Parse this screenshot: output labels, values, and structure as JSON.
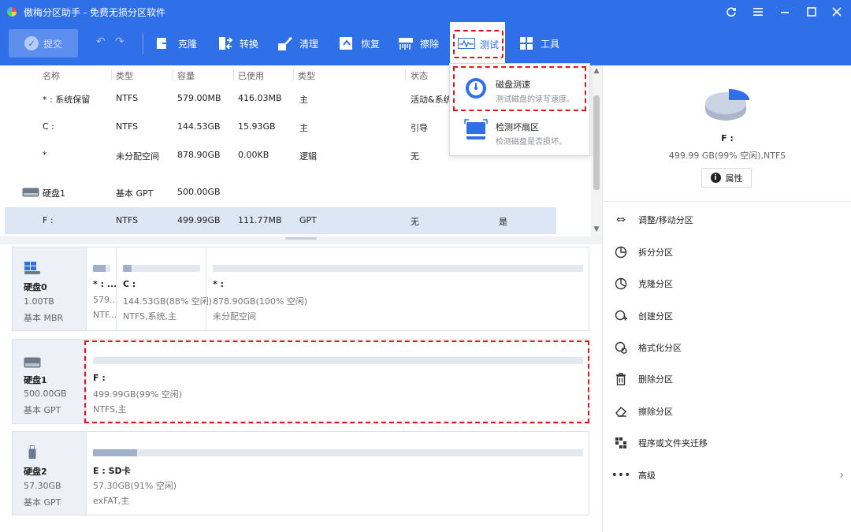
{
  "window": {
    "title": "傲梅分区助手 - 免费无损分区软件",
    "controls": [
      "refresh-icon",
      "menu-icon",
      "minimize-icon",
      "maximize-icon",
      "close-icon"
    ]
  },
  "toolbar": {
    "submit_label": "提交",
    "tools": [
      {
        "id": "clone",
        "label": "克隆",
        "icon": "clone-icon"
      },
      {
        "id": "convert",
        "label": "转换",
        "icon": "convert-icon"
      },
      {
        "id": "clean",
        "label": "清理",
        "icon": "clean-icon"
      },
      {
        "id": "recover",
        "label": "恢复",
        "icon": "recover-icon"
      },
      {
        "id": "wipe",
        "label": "擦除",
        "icon": "wipe-icon"
      },
      {
        "id": "test",
        "label": "测试",
        "icon": "test-icon"
      },
      {
        "id": "tools",
        "label": "工具",
        "icon": "tools-icon"
      }
    ],
    "active_tool": "test"
  },
  "table": {
    "headers": [
      "名称",
      "类型",
      "容量",
      "已使用",
      "类型",
      "状态"
    ],
    "rows": [
      {
        "name": "* : 系统保留",
        "type": "NTFS",
        "capacity": "579.00MB",
        "used": "416.03MB",
        "kind": "主",
        "status": "活动&系统"
      },
      {
        "name": "C :",
        "type": "NTFS",
        "capacity": "144.53GB",
        "used": "15.93GB",
        "kind": "主",
        "status": "引导"
      },
      {
        "name": "*",
        "type": "未分配空间",
        "capacity": "878.90GB",
        "used": "0.00KB",
        "kind": "逻辑",
        "status": "无"
      },
      {
        "name": "硬盘1",
        "type": "基本 GPT",
        "capacity": "500.00GB",
        "used": "",
        "kind": "",
        "status": ""
      },
      {
        "name": "F :",
        "type": "NTFS",
        "capacity": "499.99GB",
        "used": "111.77MB",
        "kind": "GPT",
        "status": "无",
        "extra": "是"
      }
    ]
  },
  "disks": [
    {
      "name": "硬盘0",
      "size": "1.00TB",
      "style": "基本 MBR",
      "partitions": [
        {
          "name": "* : ...",
          "line1": "579...",
          "line2": "NTF...",
          "used_fraction": 0.72
        },
        {
          "name": "C :",
          "line1": "144.53GB(88% 空闲)",
          "line2": "NTFS,系统,主",
          "used_fraction": 0.11
        },
        {
          "name": "* :",
          "line1": "878.90GB(100% 空闲)",
          "line2": "未分配空间",
          "used_fraction": 0.0
        }
      ]
    },
    {
      "name": "硬盘1",
      "size": "500.00GB",
      "style": "基本 GPT",
      "partitions": [
        {
          "name": "F :",
          "line1": "499.99GB(99% 空闲)",
          "line2": "NTFS,主",
          "used_fraction": 0.0
        }
      ]
    },
    {
      "name": "硬盘2",
      "size": "57.30GB",
      "style": "基本 GPT",
      "partitions": [
        {
          "name": "E : SD卡",
          "line1": "57.30GB(91% 空闲)",
          "line2": "exFAT,主",
          "used_fraction": 0.09
        }
      ]
    }
  ],
  "dropdown": {
    "items": [
      {
        "title": "磁盘测速",
        "desc": "测试磁盘的读写速度。",
        "icon": "speed-gauge-icon"
      },
      {
        "title": "检测坏扇区",
        "desc": "检测磁盘是否损坏。",
        "icon": "bad-sector-icon"
      }
    ]
  },
  "right_panel": {
    "partition_name": "F :",
    "partition_info": "499.99 GB(99% 空闲),NTFS",
    "properties_label": "属性",
    "pie_used_fraction": 0.25,
    "operations": [
      {
        "label": "调整/移动分区",
        "icon": "resize-icon"
      },
      {
        "label": "拆分分区",
        "icon": "split-icon"
      },
      {
        "label": "克隆分区",
        "icon": "clone-partition-icon"
      },
      {
        "label": "创建分区",
        "icon": "create-partition-icon"
      },
      {
        "label": "格式化分区",
        "icon": "format-icon"
      },
      {
        "label": "删除分区",
        "icon": "delete-icon"
      },
      {
        "label": "擦除分区",
        "icon": "erase-icon"
      },
      {
        "label": "程序或文件夹迁移",
        "icon": "migrate-icon"
      },
      {
        "label": "高级",
        "icon": "more-icon"
      }
    ]
  },
  "colors": {
    "accent": "#2f6fe8",
    "highlight": "#e0161e",
    "selected_row": "#dce6f5",
    "pie_used": "#2f6fe8",
    "pie_free": "#c9d3e3"
  }
}
